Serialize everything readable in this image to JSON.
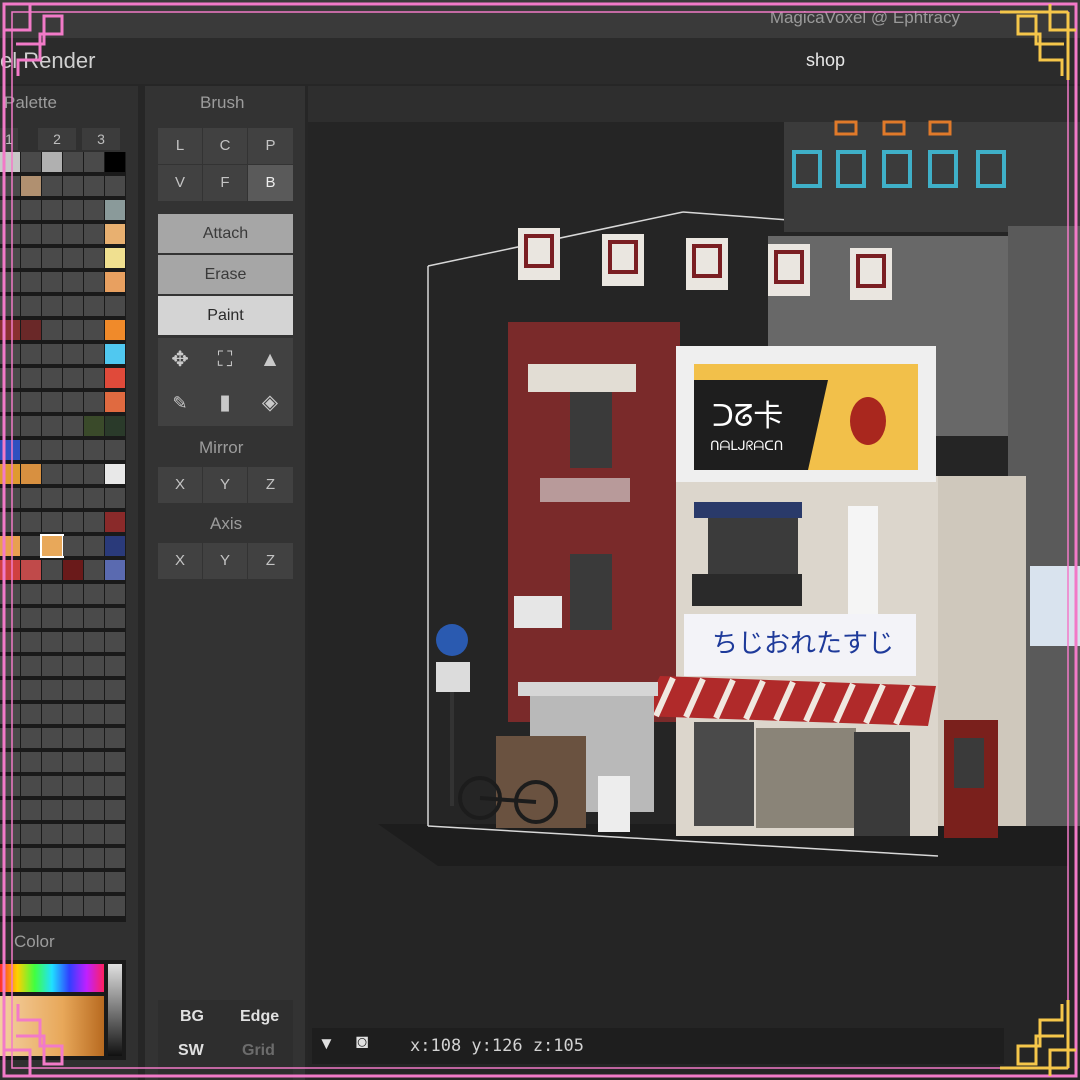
{
  "window": {
    "app_title": "MagicaVoxel @ Ephtracy",
    "document_title": "shop"
  },
  "menu": {
    "render_label": "el Render"
  },
  "palette": {
    "title": "Palette",
    "tabs": [
      "1",
      "2",
      "3"
    ],
    "selected_color": "#e8a85a"
  },
  "color_panel": {
    "title": "Color"
  },
  "brush": {
    "title": "Brush",
    "types": [
      "L",
      "C",
      "P",
      "V",
      "F",
      "B"
    ],
    "selected_type": "B",
    "modes": [
      "Attach",
      "Erase",
      "Paint"
    ],
    "selected_mode": "Paint",
    "tools": [
      "move-icon",
      "select-icon",
      "pick-icon",
      "eyedropper-icon",
      "trash-icon",
      "fill-icon"
    ]
  },
  "mirror": {
    "title": "Mirror",
    "axes": [
      "X",
      "Y",
      "Z"
    ]
  },
  "axis": {
    "title": "Axis",
    "axes": [
      "X",
      "Y",
      "Z"
    ]
  },
  "view_toggles": {
    "bg": "BG",
    "edge": "Edge",
    "sw": "SW",
    "grid": "Grid"
  },
  "scene": {
    "billboard_text": "ᑐᘔ卡",
    "billboard_sub": "ᑎᗩᒪᒍᖇᗩᑕᑎ",
    "shop_sign": "ちじおれたすじ",
    "neon_sign": "ᑕᑎ卄ᖴᖇ"
  },
  "status": {
    "coords": "x:108 y:126 z:105"
  },
  "colors": {
    "frame_pink": "#f27ac8",
    "frame_gold": "#f5c64a",
    "accent": "#e8a85a"
  }
}
